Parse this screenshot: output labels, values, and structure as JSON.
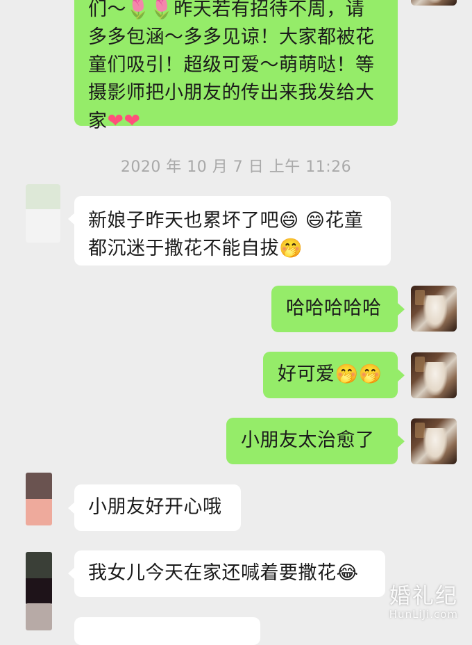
{
  "messages": [
    {
      "line1": "们～🌷🌷昨天若有招待不周，请",
      "line2": "多多包涵～多多见谅！大家都被花",
      "line3": "童们吸引！超级可爱～萌萌哒！等",
      "line4": "摄影师把小朋友的传出来我发给大",
      "line5_text": "家",
      "line5_emoji": "❤❤"
    },
    {
      "line1": "新娘子昨天也累坏了吧😄 😄花童",
      "line2": "都沉迷于撒花不能自拔🤭"
    },
    {
      "text": "哈哈哈哈哈"
    },
    {
      "text": "好可爱🤭🤭"
    },
    {
      "text": "小朋友太治愈了"
    },
    {
      "text": "小朋友好开心哦"
    },
    {
      "text": "我女儿今天在家还喊着要撒花😂"
    }
  ],
  "timestamp": "2020 年 10 月 7 日  上午 11:26",
  "watermark": {
    "cn": "婚礼纪",
    "en": "HunLiJi.com"
  },
  "colors": {
    "background": "#ededed",
    "my_bubble": "#95ec69",
    "their_bubble": "#ffffff",
    "timestamp_text": "#a9a9a9"
  }
}
